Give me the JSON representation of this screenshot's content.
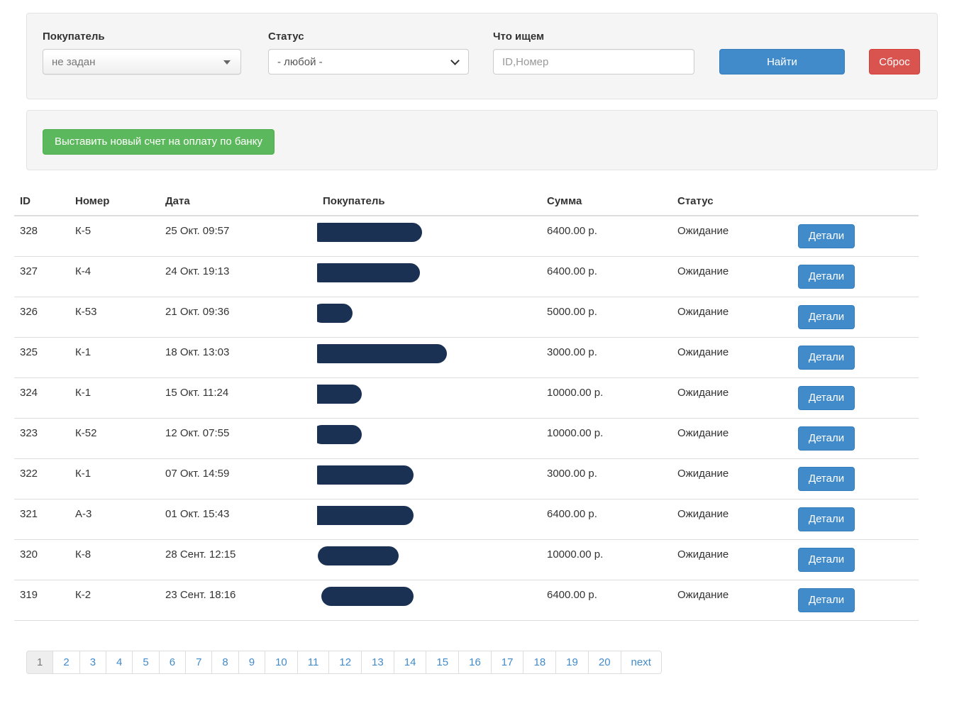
{
  "filters": {
    "buyer_label": "Покупатель",
    "buyer_value": "не задан",
    "status_label": "Статус",
    "status_value": "- любой -",
    "search_label": "Что ищем",
    "search_placeholder": "ID,Номер",
    "find_button": "Найти",
    "reset_button": "Сброс"
  },
  "actions": {
    "new_invoice_button": "Выставить новый счет на оплату по банку"
  },
  "table": {
    "headers": {
      "id": "ID",
      "number": "Номер",
      "date": "Дата",
      "buyer": "Покупатель",
      "amount": "Сумма",
      "status": "Статус"
    },
    "details_button": "Детали",
    "rows": [
      {
        "id": "328",
        "number": "К-5",
        "date": "25 Окт. 09:57",
        "buyer_redacted": true,
        "amount": "6400.00 р.",
        "status": "Ожидание"
      },
      {
        "id": "327",
        "number": "К-4",
        "date": "24 Окт. 19:13",
        "buyer_redacted": true,
        "amount": "6400.00 р.",
        "status": "Ожидание"
      },
      {
        "id": "326",
        "number": "К-53",
        "date": "21 Окт. 09:36",
        "buyer_redacted": true,
        "amount": "5000.00 р.",
        "status": "Ожидание"
      },
      {
        "id": "325",
        "number": "К-1",
        "date": "18 Окт. 13:03",
        "buyer_redacted": true,
        "amount": "3000.00 р.",
        "status": "Ожидание"
      },
      {
        "id": "324",
        "number": "К-1",
        "date": "15 Окт. 11:24",
        "buyer_redacted": true,
        "amount": "10000.00 р.",
        "status": "Ожидание"
      },
      {
        "id": "323",
        "number": "К-52",
        "date": "12 Окт. 07:55",
        "buyer_redacted": true,
        "amount": "10000.00 р.",
        "status": "Ожидание"
      },
      {
        "id": "322",
        "number": "К-1",
        "date": "07 Окт. 14:59",
        "buyer_redacted": true,
        "amount": "3000.00 р.",
        "status": "Ожидание"
      },
      {
        "id": "321",
        "number": "А-3",
        "date": "01 Окт. 15:43",
        "buyer_redacted": true,
        "amount": "6400.00 р.",
        "status": "Ожидание"
      },
      {
        "id": "320",
        "number": "К-8",
        "date": "28 Сент. 12:15",
        "buyer_redacted": true,
        "amount": "10000.00 р.",
        "status": "Ожидание"
      },
      {
        "id": "319",
        "number": "К-2",
        "date": "23 Сент. 18:16",
        "buyer_redacted": true,
        "amount": "6400.00 р.",
        "status": "Ожидание"
      }
    ]
  },
  "pagination": {
    "pages": [
      "1",
      "2",
      "3",
      "4",
      "5",
      "6",
      "7",
      "8",
      "9",
      "10",
      "11",
      "12",
      "13",
      "14",
      "15",
      "16",
      "17",
      "18",
      "19",
      "20"
    ],
    "current_page": "1",
    "next_label": "next"
  },
  "colors": {
    "primary": "#428bca",
    "danger": "#d9534f",
    "success": "#5cb85c",
    "redaction": "#1b3153"
  }
}
